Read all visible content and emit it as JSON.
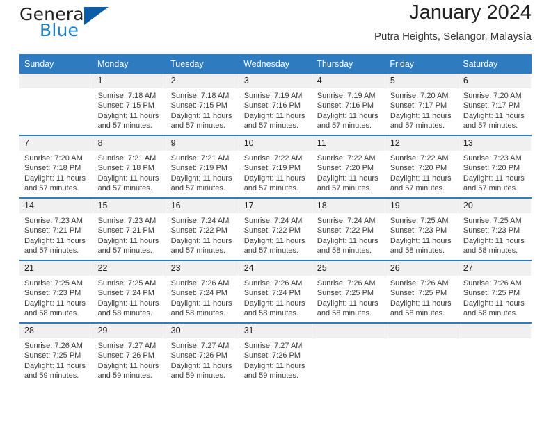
{
  "brand": {
    "name_top": "General",
    "name_bottom": "Blue",
    "triangle_color": "#0a5ea8",
    "blue_text_color": "#1f7fc4"
  },
  "header": {
    "title": "January 2024",
    "subtitle": "Putra Heights, Selangor, Malaysia"
  },
  "theme": {
    "header_blue": "#2f7bbf",
    "daynum_band": "#f0f0f0"
  },
  "weekday_headers": [
    "Sunday",
    "Monday",
    "Tuesday",
    "Wednesday",
    "Thursday",
    "Friday",
    "Saturday"
  ],
  "labels": {
    "sunrise_prefix": "Sunrise:",
    "sunset_prefix": "Sunset:",
    "daylight_prefix": "Daylight:"
  },
  "weeks": [
    [
      {
        "day": "",
        "sunrise": "",
        "sunset": "",
        "daylight": ""
      },
      {
        "day": "1",
        "sunrise": "Sunrise: 7:18 AM",
        "sunset": "Sunset: 7:15 PM",
        "daylight": "Daylight: 11 hours and 57 minutes."
      },
      {
        "day": "2",
        "sunrise": "Sunrise: 7:18 AM",
        "sunset": "Sunset: 7:15 PM",
        "daylight": "Daylight: 11 hours and 57 minutes."
      },
      {
        "day": "3",
        "sunrise": "Sunrise: 7:19 AM",
        "sunset": "Sunset: 7:16 PM",
        "daylight": "Daylight: 11 hours and 57 minutes."
      },
      {
        "day": "4",
        "sunrise": "Sunrise: 7:19 AM",
        "sunset": "Sunset: 7:16 PM",
        "daylight": "Daylight: 11 hours and 57 minutes."
      },
      {
        "day": "5",
        "sunrise": "Sunrise: 7:20 AM",
        "sunset": "Sunset: 7:17 PM",
        "daylight": "Daylight: 11 hours and 57 minutes."
      },
      {
        "day": "6",
        "sunrise": "Sunrise: 7:20 AM",
        "sunset": "Sunset: 7:17 PM",
        "daylight": "Daylight: 11 hours and 57 minutes."
      }
    ],
    [
      {
        "day": "7",
        "sunrise": "Sunrise: 7:20 AM",
        "sunset": "Sunset: 7:18 PM",
        "daylight": "Daylight: 11 hours and 57 minutes."
      },
      {
        "day": "8",
        "sunrise": "Sunrise: 7:21 AM",
        "sunset": "Sunset: 7:18 PM",
        "daylight": "Daylight: 11 hours and 57 minutes."
      },
      {
        "day": "9",
        "sunrise": "Sunrise: 7:21 AM",
        "sunset": "Sunset: 7:19 PM",
        "daylight": "Daylight: 11 hours and 57 minutes."
      },
      {
        "day": "10",
        "sunrise": "Sunrise: 7:22 AM",
        "sunset": "Sunset: 7:19 PM",
        "daylight": "Daylight: 11 hours and 57 minutes."
      },
      {
        "day": "11",
        "sunrise": "Sunrise: 7:22 AM",
        "sunset": "Sunset: 7:20 PM",
        "daylight": "Daylight: 11 hours and 57 minutes."
      },
      {
        "day": "12",
        "sunrise": "Sunrise: 7:22 AM",
        "sunset": "Sunset: 7:20 PM",
        "daylight": "Daylight: 11 hours and 57 minutes."
      },
      {
        "day": "13",
        "sunrise": "Sunrise: 7:23 AM",
        "sunset": "Sunset: 7:20 PM",
        "daylight": "Daylight: 11 hours and 57 minutes."
      }
    ],
    [
      {
        "day": "14",
        "sunrise": "Sunrise: 7:23 AM",
        "sunset": "Sunset: 7:21 PM",
        "daylight": "Daylight: 11 hours and 57 minutes."
      },
      {
        "day": "15",
        "sunrise": "Sunrise: 7:23 AM",
        "sunset": "Sunset: 7:21 PM",
        "daylight": "Daylight: 11 hours and 57 minutes."
      },
      {
        "day": "16",
        "sunrise": "Sunrise: 7:24 AM",
        "sunset": "Sunset: 7:22 PM",
        "daylight": "Daylight: 11 hours and 57 minutes."
      },
      {
        "day": "17",
        "sunrise": "Sunrise: 7:24 AM",
        "sunset": "Sunset: 7:22 PM",
        "daylight": "Daylight: 11 hours and 57 minutes."
      },
      {
        "day": "18",
        "sunrise": "Sunrise: 7:24 AM",
        "sunset": "Sunset: 7:22 PM",
        "daylight": "Daylight: 11 hours and 58 minutes."
      },
      {
        "day": "19",
        "sunrise": "Sunrise: 7:25 AM",
        "sunset": "Sunset: 7:23 PM",
        "daylight": "Daylight: 11 hours and 58 minutes."
      },
      {
        "day": "20",
        "sunrise": "Sunrise: 7:25 AM",
        "sunset": "Sunset: 7:23 PM",
        "daylight": "Daylight: 11 hours and 58 minutes."
      }
    ],
    [
      {
        "day": "21",
        "sunrise": "Sunrise: 7:25 AM",
        "sunset": "Sunset: 7:23 PM",
        "daylight": "Daylight: 11 hours and 58 minutes."
      },
      {
        "day": "22",
        "sunrise": "Sunrise: 7:25 AM",
        "sunset": "Sunset: 7:24 PM",
        "daylight": "Daylight: 11 hours and 58 minutes."
      },
      {
        "day": "23",
        "sunrise": "Sunrise: 7:26 AM",
        "sunset": "Sunset: 7:24 PM",
        "daylight": "Daylight: 11 hours and 58 minutes."
      },
      {
        "day": "24",
        "sunrise": "Sunrise: 7:26 AM",
        "sunset": "Sunset: 7:24 PM",
        "daylight": "Daylight: 11 hours and 58 minutes."
      },
      {
        "day": "25",
        "sunrise": "Sunrise: 7:26 AM",
        "sunset": "Sunset: 7:25 PM",
        "daylight": "Daylight: 11 hours and 58 minutes."
      },
      {
        "day": "26",
        "sunrise": "Sunrise: 7:26 AM",
        "sunset": "Sunset: 7:25 PM",
        "daylight": "Daylight: 11 hours and 58 minutes."
      },
      {
        "day": "27",
        "sunrise": "Sunrise: 7:26 AM",
        "sunset": "Sunset: 7:25 PM",
        "daylight": "Daylight: 11 hours and 58 minutes."
      }
    ],
    [
      {
        "day": "28",
        "sunrise": "Sunrise: 7:26 AM",
        "sunset": "Sunset: 7:25 PM",
        "daylight": "Daylight: 11 hours and 59 minutes."
      },
      {
        "day": "29",
        "sunrise": "Sunrise: 7:27 AM",
        "sunset": "Sunset: 7:26 PM",
        "daylight": "Daylight: 11 hours and 59 minutes."
      },
      {
        "day": "30",
        "sunrise": "Sunrise: 7:27 AM",
        "sunset": "Sunset: 7:26 PM",
        "daylight": "Daylight: 11 hours and 59 minutes."
      },
      {
        "day": "31",
        "sunrise": "Sunrise: 7:27 AM",
        "sunset": "Sunset: 7:26 PM",
        "daylight": "Daylight: 11 hours and 59 minutes."
      },
      {
        "day": "",
        "sunrise": "",
        "sunset": "",
        "daylight": ""
      },
      {
        "day": "",
        "sunrise": "",
        "sunset": "",
        "daylight": ""
      },
      {
        "day": "",
        "sunrise": "",
        "sunset": "",
        "daylight": ""
      }
    ]
  ]
}
